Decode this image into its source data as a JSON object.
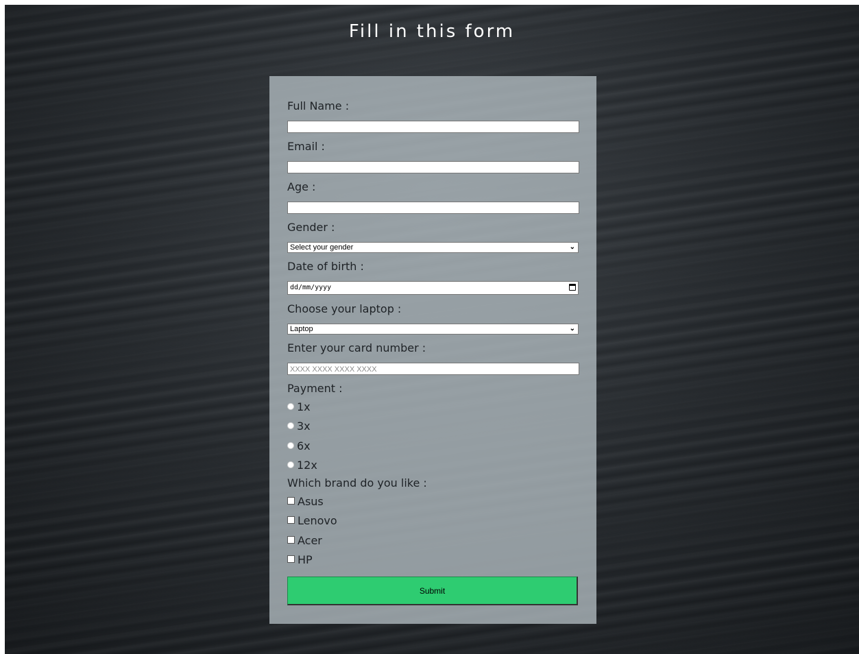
{
  "page": {
    "title": "Fill in this form"
  },
  "form": {
    "full_name": {
      "label": "Full Name :",
      "value": ""
    },
    "email": {
      "label": "Email :",
      "value": ""
    },
    "age": {
      "label": "Age :",
      "value": ""
    },
    "gender": {
      "label": "Gender :",
      "selected": "Select your gender"
    },
    "dob": {
      "label": "Date of birth :",
      "placeholder": "dd/mm/yyyy"
    },
    "laptop": {
      "label": "Choose your laptop :",
      "selected": "Laptop"
    },
    "card": {
      "label": "Enter your card number :",
      "placeholder": "XXXX XXXX XXXX XXXX"
    },
    "payment": {
      "label": "Payment :",
      "options": [
        "1x",
        "3x",
        "6x",
        "12x"
      ]
    },
    "brands": {
      "label": "Which brand do you like :",
      "options": [
        "Asus",
        "Lenovo",
        "Acer",
        "HP"
      ]
    },
    "submit_label": "Submit"
  },
  "colors": {
    "submit_bg": "#2ecc71",
    "panel_bg": "#b2bcc2"
  },
  "icons": {
    "select_arrow": "chevron-down-icon",
    "date_picker": "calendar-icon"
  }
}
